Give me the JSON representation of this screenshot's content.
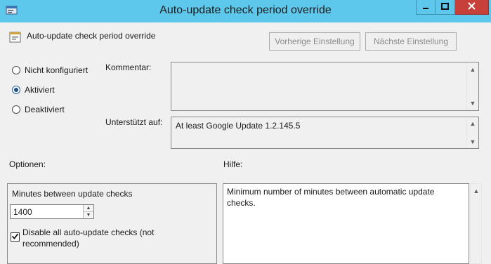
{
  "window": {
    "title": "Auto-update check period override",
    "icon": "policy-settings-icon",
    "titlebar_color": "#5ec8ec",
    "close_color": "#c7403a"
  },
  "header": {
    "policy_name": "Auto-update check period override",
    "prev_button": "Vorherige Einstellung",
    "next_button": "Nächste Einstellung"
  },
  "state": {
    "options": [
      {
        "label": "Nicht konfiguriert",
        "checked": false
      },
      {
        "label": "Aktiviert",
        "checked": true
      },
      {
        "label": "Deaktiviert",
        "checked": false
      }
    ]
  },
  "comment": {
    "label": "Kommentar:",
    "value": ""
  },
  "supported": {
    "label": "Unterstützt auf:",
    "value": "At least Google Update 1.2.145.5"
  },
  "options_section": {
    "label": "Optionen:",
    "minutes_label": "Minutes between update checks",
    "minutes_value": "1400",
    "disable_label": "Disable all auto-update checks (not recommended)",
    "disable_checked": true
  },
  "help_section": {
    "label": "Hilfe:",
    "text": "Minimum number of minutes between automatic update checks."
  }
}
